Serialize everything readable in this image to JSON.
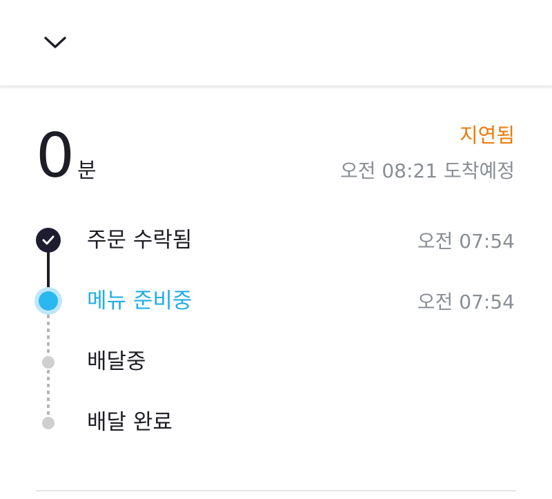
{
  "header": {
    "collapse_icon": "chevron-down-icon"
  },
  "eta": {
    "minutes": "0",
    "unit": "분",
    "status": "지연됨",
    "arrival": "오전 08:21 도착예정"
  },
  "colors": {
    "delay": "#ea7b08",
    "current_step": "#22ace8",
    "done_step": "#1d1d2f",
    "pending_step": "#cfcfcf",
    "muted_text": "#898e94"
  },
  "steps": [
    {
      "label": "주문 수락됨",
      "time": "오전 07:54",
      "state": "done",
      "icon": "checkmark-icon"
    },
    {
      "label": "메뉴 준비중",
      "time": "오전 07:54",
      "state": "current"
    },
    {
      "label": "배달중",
      "time": "",
      "state": "pending"
    },
    {
      "label": "배달 완료",
      "time": "",
      "state": "pending"
    }
  ]
}
